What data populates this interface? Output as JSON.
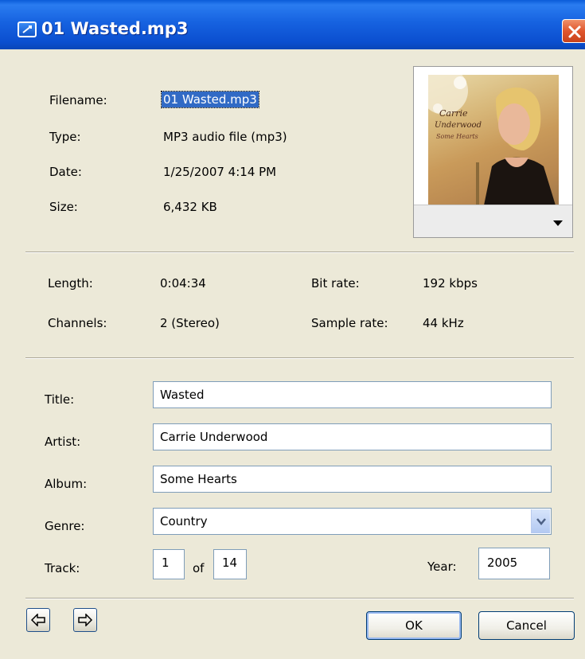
{
  "window": {
    "title": "01 Wasted.mp3"
  },
  "file_info": {
    "filename_label": "Filename:",
    "filename_value": "01 Wasted.mp3",
    "type_label": "Type:",
    "type_value": "MP3 audio file (mp3)",
    "date_label": "Date:",
    "date_value": "1/25/2007 4:14 PM",
    "size_label": "Size:",
    "size_value": "6,432 KB"
  },
  "album_art": {
    "title_lines": [
      "Carrie",
      "Underwood",
      "Some Hearts"
    ]
  },
  "audio_info": {
    "length_label": "Length:",
    "length_value": "0:04:34",
    "bitrate_label": "Bit rate:",
    "bitrate_value": "192 kbps",
    "channels_label": "Channels:",
    "channels_value": "2 (Stereo)",
    "samplerate_label": "Sample rate:",
    "samplerate_value": "44 kHz"
  },
  "tags": {
    "title_label": "Title:",
    "title_value": "Wasted",
    "artist_label": "Artist:",
    "artist_value": "Carrie Underwood",
    "album_label": "Album:",
    "album_value": "Some Hearts",
    "genre_label": "Genre:",
    "genre_value": "Country",
    "track_label": "Track:",
    "track_value": "1",
    "of_label": "of",
    "track_total": "14",
    "year_label": "Year:",
    "year_value": "2005"
  },
  "buttons": {
    "ok": "OK",
    "cancel": "Cancel"
  },
  "icons": {
    "app": "media-player-icon",
    "close": "close-icon",
    "art_dropdown": "triangle-down-icon",
    "genre_dropdown": "chevron-down-icon",
    "prev": "arrow-left-icon",
    "next": "arrow-right-icon"
  },
  "colors": {
    "titlebar": "#0b55d5",
    "dialog_bg": "#ece9d8",
    "selection": "#316ac5",
    "close_btn": "#e0562d"
  }
}
